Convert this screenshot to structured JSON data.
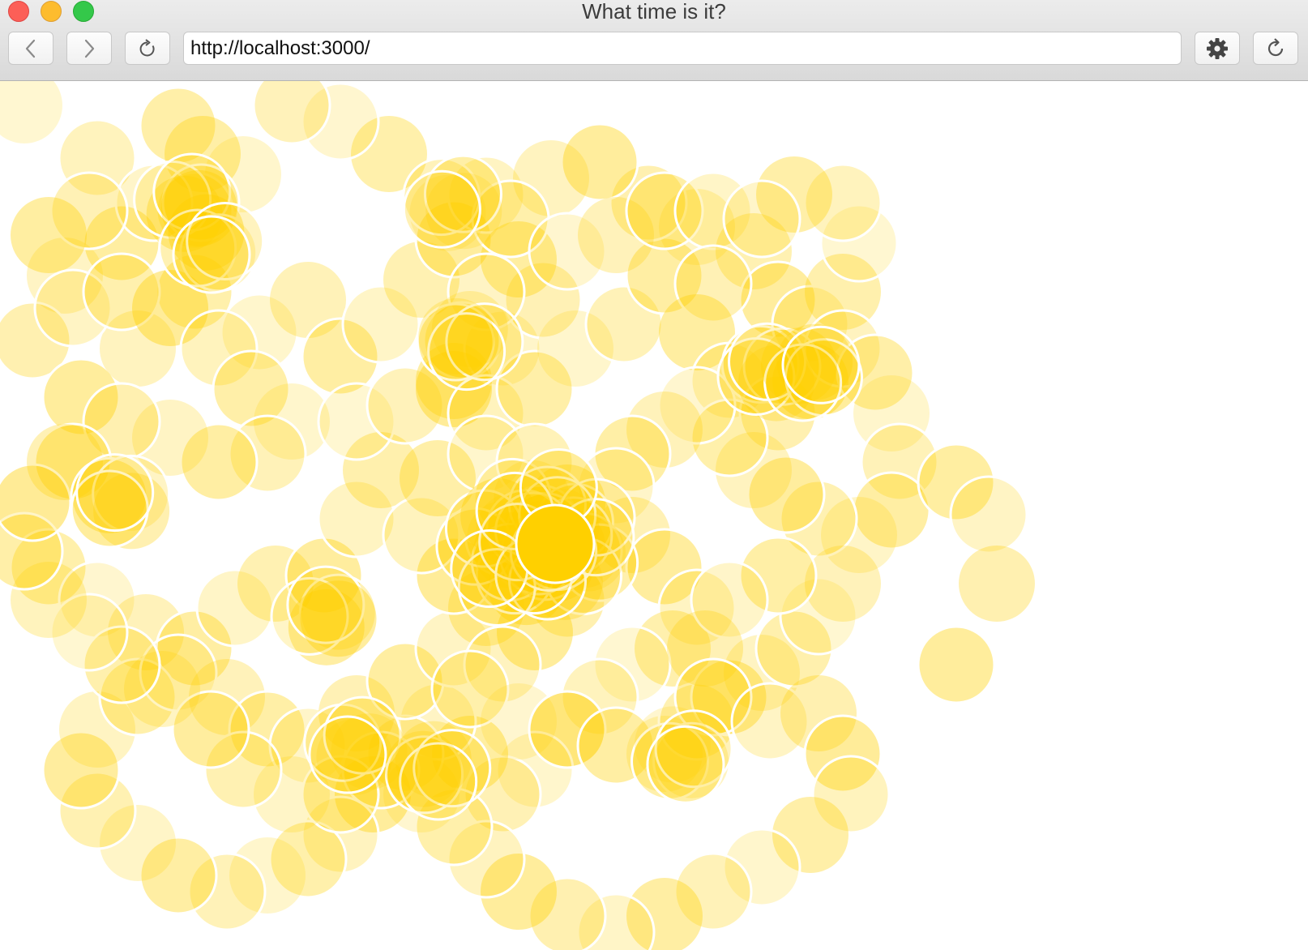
{
  "window": {
    "title": "What time is it?"
  },
  "toolbar": {
    "back_icon": "chevron-left-icon",
    "forward_icon": "chevron-right-icon",
    "reload_icon": "reload-icon",
    "settings_icon": "gear-icon",
    "refresh_icon": "refresh-icon"
  },
  "address": {
    "url": "http://localhost:3000/"
  },
  "colors": {
    "circle_fill": "#ffd000",
    "circle_stroke": "#ffffff",
    "focus_circle": "#ffd000"
  }
}
